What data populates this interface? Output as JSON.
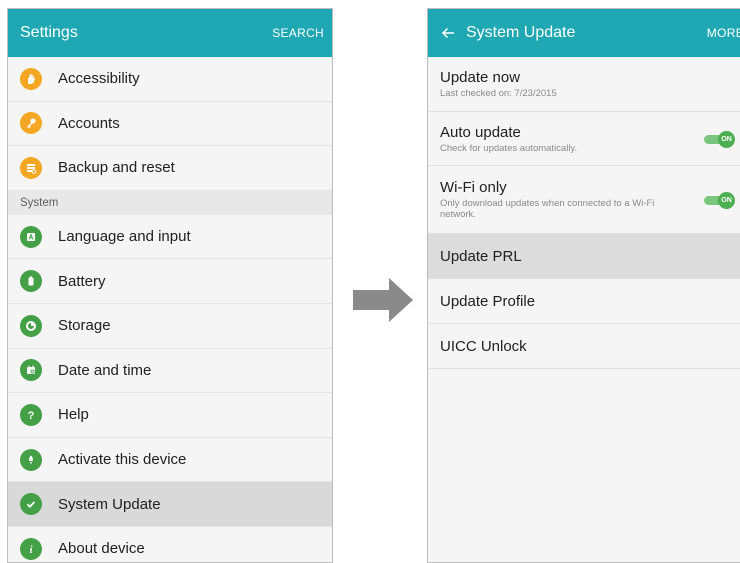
{
  "left": {
    "appbar": {
      "title": "Settings",
      "action": "SEARCH"
    },
    "items_top": [
      {
        "label": "Accessibility",
        "icon": "hand-icon",
        "color": "#f5a623"
      },
      {
        "label": "Accounts",
        "icon": "key-icon",
        "color": "#f5a623"
      },
      {
        "label": "Backup and reset",
        "icon": "backup-icon",
        "color": "#f5a623"
      }
    ],
    "section_header": "System",
    "items_system": [
      {
        "label": "Language and input",
        "icon": "language-icon",
        "color": "#43a047"
      },
      {
        "label": "Battery",
        "icon": "battery-icon",
        "color": "#43a047"
      },
      {
        "label": "Storage",
        "icon": "storage-icon",
        "color": "#43a047"
      },
      {
        "label": "Date and time",
        "icon": "calendar-icon",
        "color": "#43a047"
      },
      {
        "label": "Help",
        "icon": "help-icon",
        "color": "#43a047"
      },
      {
        "label": "Activate this device",
        "icon": "activate-icon",
        "color": "#43a047"
      },
      {
        "label": "System Update",
        "icon": "check-icon",
        "color": "#43a047",
        "selected": true
      },
      {
        "label": "About device",
        "icon": "info-icon",
        "color": "#43a047"
      }
    ]
  },
  "right": {
    "appbar": {
      "title": "System Update",
      "action": "MORE"
    },
    "update_now": {
      "title": "Update now",
      "subtitle": "Last checked on: 7/23/2015"
    },
    "auto_update": {
      "title": "Auto update",
      "subtitle": "Check for updates automatically.",
      "toggle": "ON"
    },
    "wifi_only": {
      "title": "Wi-Fi only",
      "subtitle": "Only download updates when connected to a Wi-Fi network.",
      "toggle": "ON"
    },
    "update_prl": {
      "title": "Update PRL"
    },
    "update_profile": {
      "title": "Update Profile"
    },
    "uicc_unlock": {
      "title": "UICC Unlock"
    }
  },
  "colors": {
    "appbar": "#1fa8b4",
    "accent_orange": "#f5a623",
    "accent_green": "#43a047",
    "toggle_green": "#4caf50"
  }
}
